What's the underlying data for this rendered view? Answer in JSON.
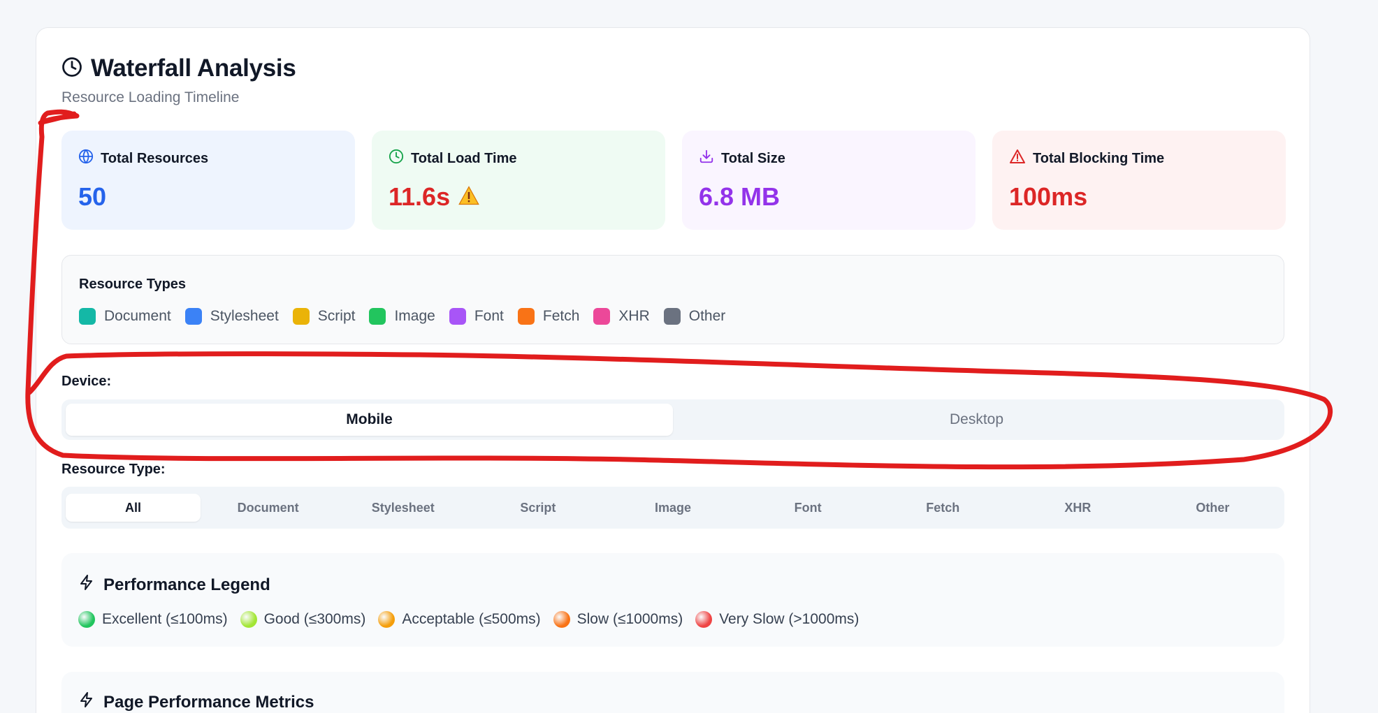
{
  "header": {
    "title": "Waterfall Analysis",
    "subtitle": "Resource Loading Timeline"
  },
  "stats": [
    {
      "label": "Total Resources",
      "value": "50",
      "icon": "globe-icon"
    },
    {
      "label": "Total Load Time",
      "value": "11.6s",
      "icon": "clock-icon",
      "warning_icon": "warning-icon"
    },
    {
      "label": "Total Size",
      "value": "6.8 MB",
      "icon": "download-icon"
    },
    {
      "label": "Total Blocking Time",
      "value": "100ms",
      "icon": "alert-triangle-icon"
    }
  ],
  "resource_types": {
    "title": "Resource Types",
    "items": [
      {
        "label": "Document",
        "color": "#14b8a6"
      },
      {
        "label": "Stylesheet",
        "color": "#3b82f6"
      },
      {
        "label": "Script",
        "color": "#eab308"
      },
      {
        "label": "Image",
        "color": "#22c55e"
      },
      {
        "label": "Font",
        "color": "#a855f7"
      },
      {
        "label": "Fetch",
        "color": "#f97316"
      },
      {
        "label": "XHR",
        "color": "#ec4899"
      },
      {
        "label": "Other",
        "color": "#6b7280"
      }
    ]
  },
  "device": {
    "label": "Device:",
    "options": [
      "Mobile",
      "Desktop"
    ],
    "selected": "Mobile"
  },
  "resource_filter": {
    "label": "Resource Type:",
    "options": [
      "All",
      "Document",
      "Stylesheet",
      "Script",
      "Image",
      "Font",
      "Fetch",
      "XHR",
      "Other"
    ],
    "selected": "All"
  },
  "performance_legend": {
    "title": "Performance Legend",
    "items": [
      {
        "label": "Excellent (≤100ms)",
        "color": "#22c55e"
      },
      {
        "label": "Good (≤300ms)",
        "color": "#a3e635"
      },
      {
        "label": "Acceptable (≤500ms)",
        "color": "#f59e0b"
      },
      {
        "label": "Slow (≤1000ms)",
        "color": "#f97316"
      },
      {
        "label": "Very Slow (>1000ms)",
        "color": "#ef4444"
      }
    ]
  },
  "metrics": {
    "title": "Page Performance Metrics"
  },
  "colors": {
    "annotation": "#e11d1d"
  }
}
